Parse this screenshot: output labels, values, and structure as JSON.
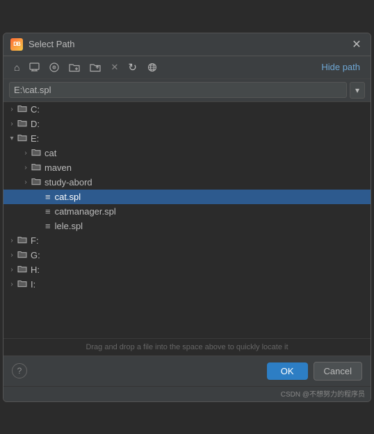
{
  "dialog": {
    "title": "Select Path",
    "icon_text": "DB",
    "close_label": "✕"
  },
  "toolbar": {
    "hide_path_label": "Hide path",
    "buttons": [
      {
        "name": "home-icon",
        "symbol": "⌂",
        "interactable": true
      },
      {
        "name": "monitor-icon",
        "symbol": "🖥",
        "interactable": true
      },
      {
        "name": "cd-icon",
        "symbol": "💿",
        "interactable": true
      },
      {
        "name": "folder-new-icon",
        "symbol": "📁",
        "interactable": true
      },
      {
        "name": "folder-up-icon",
        "symbol": "📂",
        "interactable": true
      },
      {
        "name": "delete-icon",
        "symbol": "✕",
        "interactable": true
      },
      {
        "name": "refresh-icon",
        "symbol": "↻",
        "interactable": true
      },
      {
        "name": "network-icon",
        "symbol": "🔗",
        "interactable": true
      }
    ]
  },
  "path_bar": {
    "value": "E:\\cat.spl",
    "dropdown_symbol": "▾"
  },
  "tree": {
    "items": [
      {
        "id": "c-drive",
        "level": 0,
        "expanded": false,
        "type": "drive",
        "label": "C:",
        "icon": "📁"
      },
      {
        "id": "d-drive",
        "level": 0,
        "expanded": false,
        "type": "drive",
        "label": "D:",
        "icon": "📁"
      },
      {
        "id": "e-drive",
        "level": 0,
        "expanded": true,
        "type": "drive",
        "label": "E:",
        "icon": "📁"
      },
      {
        "id": "e-cat",
        "level": 1,
        "expanded": false,
        "type": "folder",
        "label": "cat",
        "icon": "📁"
      },
      {
        "id": "e-maven",
        "level": 1,
        "expanded": false,
        "type": "folder",
        "label": "maven",
        "icon": "📁"
      },
      {
        "id": "e-study",
        "level": 1,
        "expanded": false,
        "type": "folder",
        "label": "study-abord",
        "icon": "📁"
      },
      {
        "id": "e-cat-spl",
        "level": 2,
        "expanded": false,
        "type": "file",
        "label": "cat.spl",
        "icon": "≡",
        "selected": true
      },
      {
        "id": "e-catmanager-spl",
        "level": 2,
        "expanded": false,
        "type": "file",
        "label": "catmanager.spl",
        "icon": "≡"
      },
      {
        "id": "e-lele-spl",
        "level": 2,
        "expanded": false,
        "type": "file",
        "label": "lele.spl",
        "icon": "≡"
      },
      {
        "id": "f-drive",
        "level": 0,
        "expanded": false,
        "type": "drive",
        "label": "F:",
        "icon": "📁"
      },
      {
        "id": "g-drive",
        "level": 0,
        "expanded": false,
        "type": "drive",
        "label": "G:",
        "icon": "📁"
      },
      {
        "id": "h-drive",
        "level": 0,
        "expanded": false,
        "type": "drive",
        "label": "H:",
        "icon": "📁"
      },
      {
        "id": "i-drive",
        "level": 0,
        "expanded": false,
        "type": "drive",
        "label": "I:",
        "icon": "📁"
      }
    ]
  },
  "drag_hint": "Drag and drop a file into the space above to quickly locate it",
  "footer": {
    "help_symbol": "?",
    "ok_label": "OK",
    "cancel_label": "Cancel"
  },
  "watermark": "CSDN @不想努力的程序员"
}
